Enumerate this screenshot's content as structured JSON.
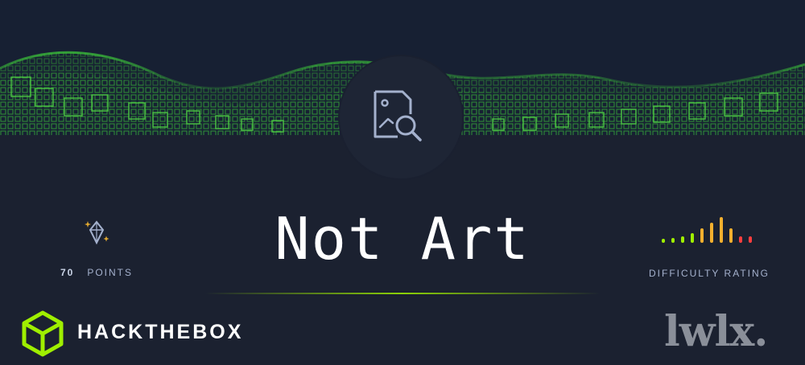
{
  "challenge": {
    "title": "Not Art",
    "category_icon": "image-search-icon"
  },
  "points": {
    "icon": "diamond-sparkle-icon",
    "value": "70",
    "label": "POINTS"
  },
  "difficulty": {
    "label": "DIFFICULTY RATING",
    "bars_icon": "difficulty-bars-icon"
  },
  "brand": {
    "logo_icon": "hackthebox-cube-icon",
    "name": "HACKTHEBOX"
  },
  "watermark": {
    "text": "lwlx."
  },
  "colors": {
    "background": "#1b2130",
    "accent_green": "#9fef00",
    "wave_green": "#39c234",
    "text_muted": "#a4b1cd"
  }
}
